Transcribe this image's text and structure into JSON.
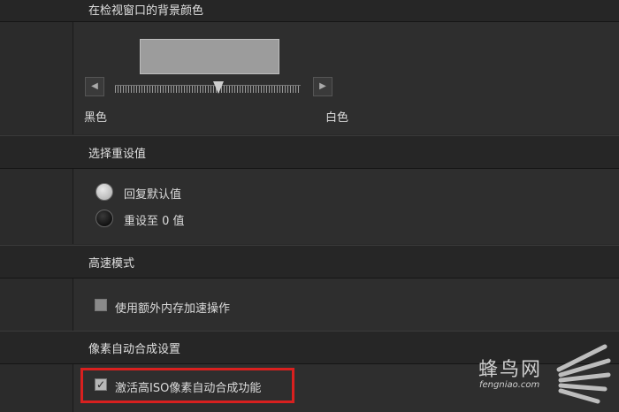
{
  "bg_color_section": {
    "header": "在检视窗口的背景颜色",
    "left_arrow": "◀",
    "right_arrow": "▶",
    "label_black": "黑色",
    "label_white": "白色"
  },
  "reset_section": {
    "header": "选择重设值",
    "option_default": "回复默认值",
    "option_zero": "重设至 0 值"
  },
  "speed_section": {
    "header": "高速模式",
    "checkbox_label": "使用额外内存加速操作"
  },
  "pixel_section": {
    "header": "像素自动合成设置",
    "checkbox_label": "激活高ISO像素自动合成功能",
    "check_mark": "✓"
  },
  "watermark": {
    "title": "蜂鸟网",
    "subtitle": "fengniao.com"
  },
  "colors": {
    "highlight_border": "#d9201f",
    "preview_swatch": "#9c9c9c"
  }
}
